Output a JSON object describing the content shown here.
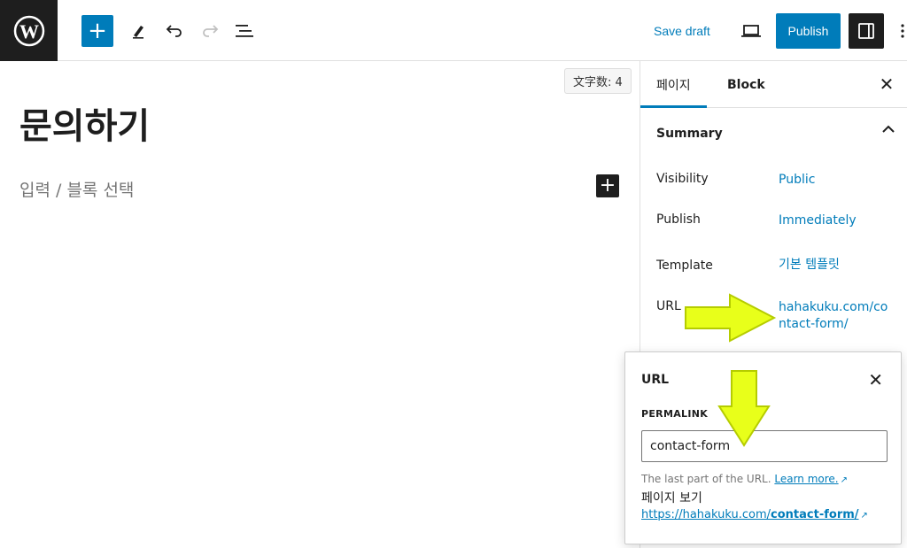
{
  "toolbar": {
    "save_draft": "Save draft",
    "publish": "Publish",
    "icons": [
      "wordpress-logo",
      "plus-icon",
      "pencil-icon",
      "undo-icon",
      "redo-icon",
      "list-view-icon",
      "preview-icon",
      "settings-sidebar-icon",
      "more-menu-icon"
    ]
  },
  "editor": {
    "word_count": "文字数: 4",
    "title": "문의하기",
    "placeholder": "입력 / 블록 선택"
  },
  "sidebar": {
    "tabs": [
      "페이지",
      "Block"
    ],
    "summary_title": "Summary",
    "rows": [
      {
        "label": "Visibility",
        "value": "Public"
      },
      {
        "label": "Publish",
        "value": "Immediately"
      },
      {
        "label": "Template",
        "value": "기본 템플릿"
      },
      {
        "label": "URL",
        "value": "hahakuku.com/contact-form/"
      }
    ]
  },
  "url_popover": {
    "title": "URL",
    "permalink_label": "PERMALINK",
    "slug_value": "contact-form",
    "help_text": "The last part of the URL.",
    "learn_more": "Learn more.",
    "view_label": "페이지 보기",
    "full_url_prefix": "https://hahakuku.com/",
    "full_url_slug": "contact-form/"
  },
  "colors": {
    "accent": "#007cba",
    "dark": "#1e1e1e",
    "annotation_arrow": "#e8ff1a"
  }
}
